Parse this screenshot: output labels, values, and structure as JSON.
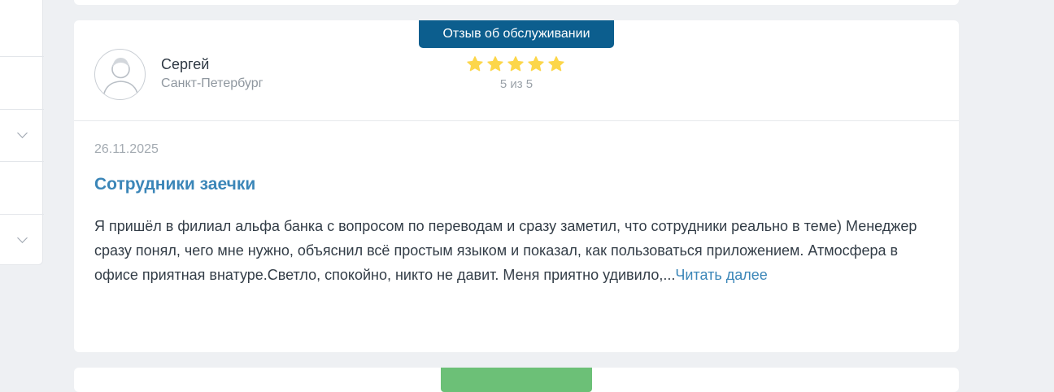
{
  "review": {
    "badge": "Отзыв об обслуживании",
    "author": {
      "name": "Сергей",
      "city": "Санкт-Петербург"
    },
    "rating": {
      "value": 5,
      "max": 5,
      "label": "5 из 5"
    },
    "date": "26.11.2025",
    "title": "Сотрудники заечки",
    "text": "Я пришёл в филиал альфа банка с вопросом по переводам и сразу заметил, что сотрудники реально в теме) Менеджер сразу понял, чего мне нужно, объяснил всё простым языком и показал, как пользоваться приложением. Атмосфера в офисе приятная внатуре.Светло, спокойно, никто не давит. Меня приятно удивило,...",
    "read_more": "Читать далее"
  },
  "colors": {
    "badge": "#0c5e8e",
    "link": "#3b86b8",
    "star": "#fcd64a",
    "next_badge": "#6cc077"
  },
  "icons": {
    "avatar": "user-avatar-icon",
    "star": "star-icon",
    "chevron": "chevron-down-icon"
  }
}
